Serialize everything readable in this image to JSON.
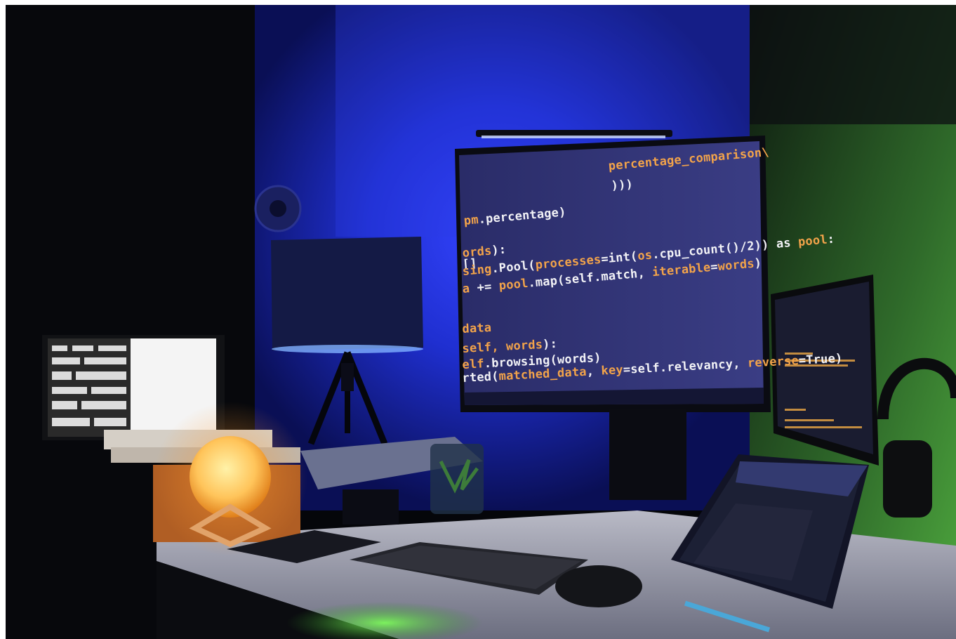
{
  "image": {
    "subject": "workstation-desk",
    "colors": {
      "wall_blue": "#1f2fd0",
      "wall_green": "#2f6a2a",
      "lamp_glow": "#ffb347",
      "screen_bg": "#2d3070",
      "code_white": "#f2f2f6",
      "code_orange": "#f2a34a"
    }
  },
  "main_monitor": {
    "code_lines": [
      [
        {
          "t": "percentage_comparison\\",
          "c": "orange"
        }
      ],
      [
        {
          "t": ")))",
          "c": "white"
        }
      ],
      [
        {
          "t": "pm",
          "c": "orange"
        },
        {
          "t": ".percentage)",
          "c": "white"
        }
      ],
      [
        {
          "t": "ords",
          "c": "orange"
        },
        {
          "t": "):",
          "c": "white"
        }
      ],
      [
        {
          "t": "[]",
          "c": "white"
        }
      ],
      [
        {
          "t": "sing",
          "c": "orange"
        },
        {
          "t": ".Pool(",
          "c": "white"
        },
        {
          "t": "processes",
          "c": "orange"
        },
        {
          "t": "=int(",
          "c": "white"
        },
        {
          "t": "os",
          "c": "orange"
        },
        {
          "t": ".cpu_count()/2)) as ",
          "c": "white"
        },
        {
          "t": "pool",
          "c": "orange"
        },
        {
          "t": ":",
          "c": "white"
        }
      ],
      [
        {
          "t": "a",
          "c": "orange"
        },
        {
          "t": " += ",
          "c": "white"
        },
        {
          "t": "pool",
          "c": "orange"
        },
        {
          "t": ".map(self.match, ",
          "c": "white"
        },
        {
          "t": "iterable",
          "c": "orange"
        },
        {
          "t": "=",
          "c": "white"
        },
        {
          "t": "words",
          "c": "orange"
        },
        {
          "t": ")",
          "c": "white"
        }
      ],
      [
        {
          "t": "data",
          "c": "orange"
        }
      ],
      [
        {
          "t": "self, words",
          "c": "orange"
        },
        {
          "t": "):",
          "c": "white"
        }
      ],
      [
        {
          "t": "elf",
          "c": "orange"
        },
        {
          "t": ".browsing(words)",
          "c": "white"
        }
      ],
      [
        {
          "t": "rted(",
          "c": "white"
        },
        {
          "t": "matched_data",
          "c": "orange"
        },
        {
          "t": ", ",
          "c": "white"
        },
        {
          "t": "key",
          "c": "orange"
        },
        {
          "t": "=self.relevancy, ",
          "c": "white"
        },
        {
          "t": "reverse",
          "c": "orange"
        },
        {
          "t": "=True)",
          "c": "white"
        }
      ]
    ]
  }
}
